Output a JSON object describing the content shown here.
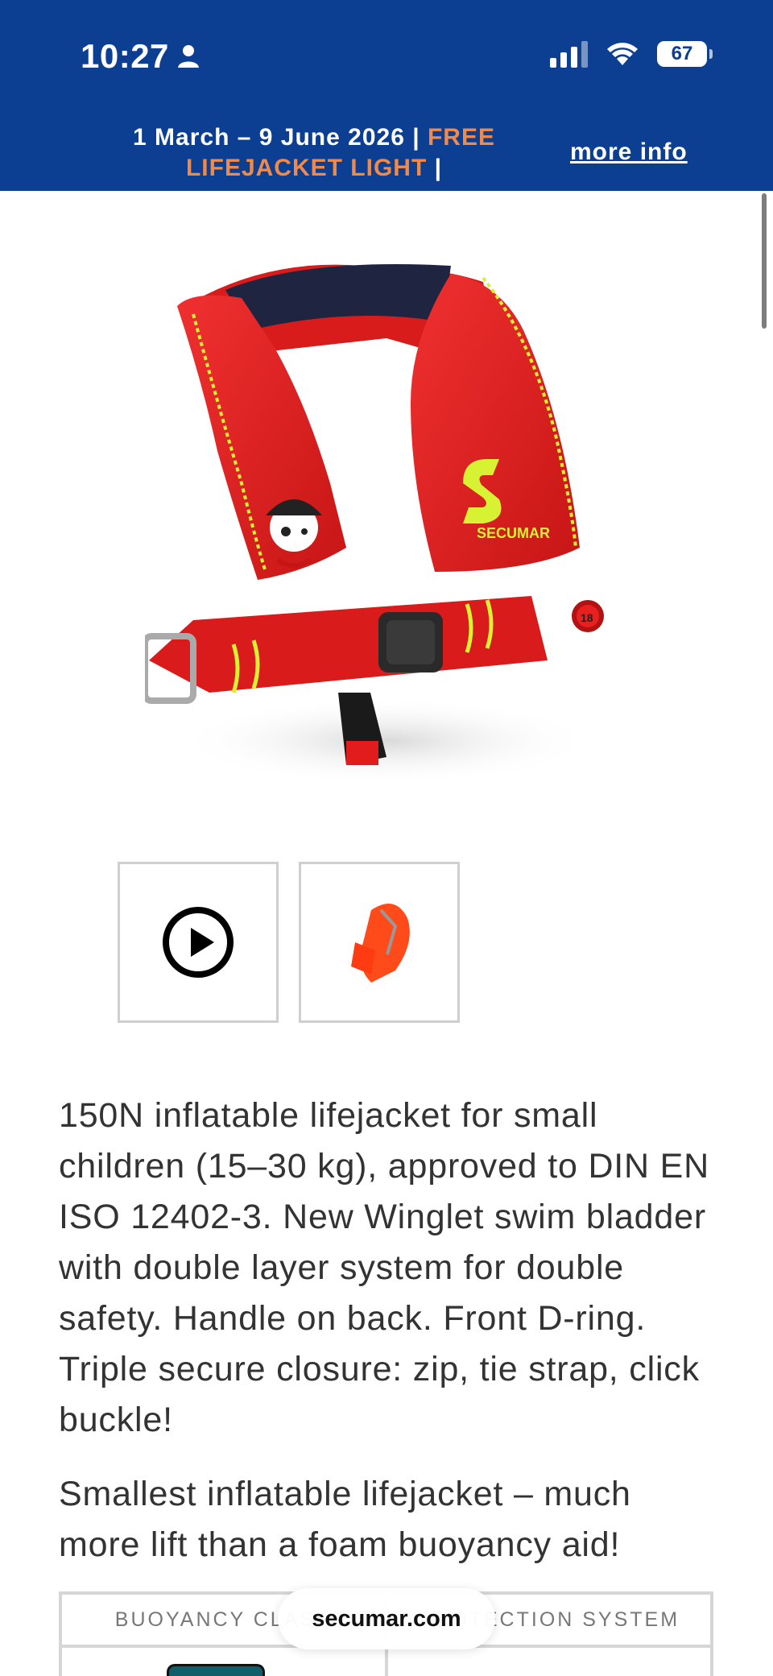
{
  "status_bar": {
    "time": "10:27",
    "battery": "67"
  },
  "promo_banner": {
    "dates": "1 March – 9 June 2026 |",
    "offer": "FREE LIFEJACKET LIGHT",
    "trailing": "|",
    "more_info": "more info"
  },
  "product": {
    "image_icon": "lifejacket-product-image",
    "logo_text": "SECUMAR",
    "badge_number": "18"
  },
  "thumbnails": [
    {
      "type": "video",
      "icon": "play-circle-icon"
    },
    {
      "type": "image",
      "icon": "lifejacket-thumbnail"
    }
  ],
  "description": {
    "paragraph_1": "150N inflatable lifejacket for small children (15–30 kg), approved to DIN EN ISO 12402-3. New Winglet swim bladder with double layer system for double safety. Handle on back. Front D-ring. Triple secure closure: zip, tie strap, click buckle!",
    "paragraph_2": "Smallest inflatable lifejacket – much more lift than a foam buoyancy aid!"
  },
  "spec_table": {
    "col_1": "BUOYANCY CLASS",
    "col_2": "PROTECTION SYSTEM"
  },
  "browser": {
    "url": "secumar.com"
  },
  "colors": {
    "header_blue": "#0c3f92",
    "promo_orange": "#f08a4b",
    "vest_red": "#e21c1c",
    "accent_yellow": "#d6f233"
  }
}
